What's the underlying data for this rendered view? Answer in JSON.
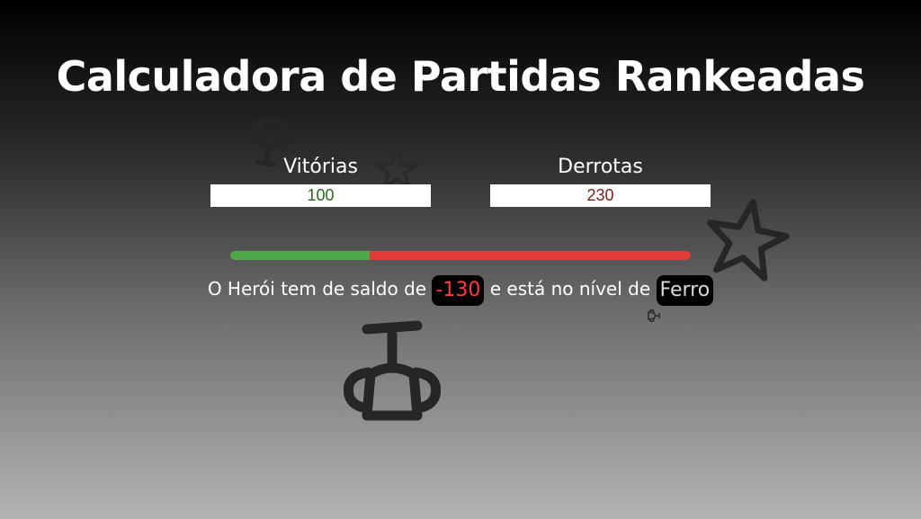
{
  "app": {
    "title": "Calculadora de Partidas Rankeadas"
  },
  "form": {
    "wins_label": "Vitórias",
    "wins_value": "100",
    "losses_label": "Derrotas",
    "losses_value": "230"
  },
  "progress": {
    "wins_fraction": 0.303,
    "win_color": "#4da84a",
    "loss_color": "#e03b37"
  },
  "result": {
    "prefix": "O Herói tem de saldo de",
    "balance": "-130",
    "middle": "e está no nível de",
    "level": "Ferro"
  },
  "icons": {
    "decorations": [
      "trophy-icon",
      "star-icon",
      "star-icon",
      "trophy-icon",
      "trophy-icon"
    ]
  }
}
